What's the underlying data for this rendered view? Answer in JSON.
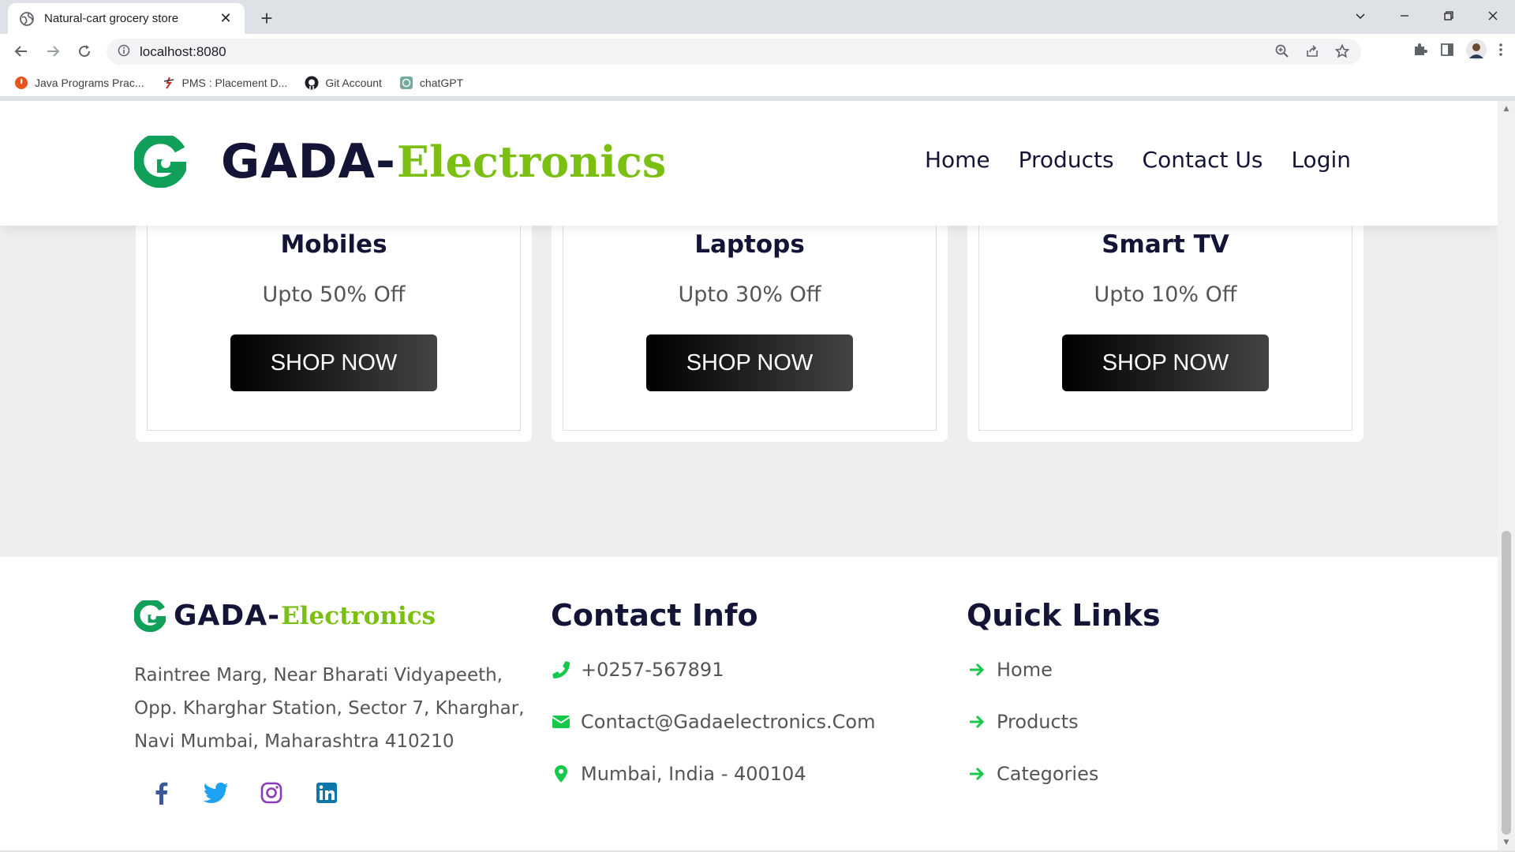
{
  "browser": {
    "tab_title": "Natural-cart grocery store",
    "url": "localhost:8080",
    "bookmarks": [
      {
        "label": "Java Programs Prac...",
        "icon": "java-icon"
      },
      {
        "label": "PMS : Placement D...",
        "icon": "pms-icon"
      },
      {
        "label": "Git Account",
        "icon": "github-icon"
      },
      {
        "label": "chatGPT",
        "icon": "chatgpt-icon"
      }
    ]
  },
  "header": {
    "brand_primary": "GADA",
    "brand_dash": "-",
    "brand_secondary": "Electronics",
    "nav": [
      "Home",
      "Products",
      "Contact Us",
      "Login"
    ]
  },
  "cards": [
    {
      "title": "Mobiles",
      "offer": "Upto 50% Off",
      "button": "SHOP NOW"
    },
    {
      "title": "Laptops",
      "offer": "Upto 30% Off",
      "button": "SHOP NOW"
    },
    {
      "title": "Smart TV",
      "offer": "Upto 10% Off",
      "button": "SHOP NOW"
    }
  ],
  "footer": {
    "brand_primary": "GADA",
    "brand_dash": "-",
    "brand_secondary": "Electronics",
    "address_lines": [
      "Raintree Marg, Near Bharati Vidyapeeth,",
      "Opp. Kharghar Station, Sector 7, Kharghar,",
      "Navi Mumbai, Maharashtra 410210"
    ],
    "socials": [
      "facebook-icon",
      "twitter-icon",
      "instagram-icon",
      "linkedin-icon"
    ],
    "contact_heading": "Contact Info",
    "contact": [
      {
        "icon": "phone-icon",
        "text": "+0257-567891"
      },
      {
        "icon": "envelope-icon",
        "text": "Contact@Gadaelectronics.Com"
      },
      {
        "icon": "location-pin-icon",
        "text": "Mumbai, India - 400104"
      }
    ],
    "links_heading": "Quick Links",
    "links": [
      "Home",
      "Products",
      "Categories"
    ]
  },
  "colors": {
    "brand_dark": "#141436",
    "brand_green": "#7bbf12",
    "logo_green": "#11a05a",
    "accent_green": "#17c94a"
  }
}
